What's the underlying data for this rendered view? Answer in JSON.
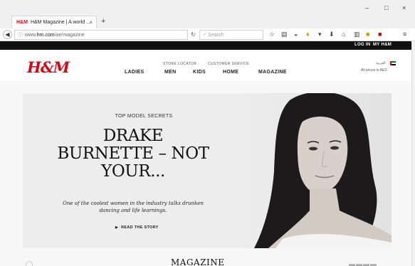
{
  "browser": {
    "tab_title": "H&M Magazine | A world ...",
    "tab_favicon": "H&M",
    "url_prefix": "www.",
    "url_domain": "hm.com",
    "url_path": "/ae/magazine",
    "search_placeholder": "Search",
    "window_controls": {
      "minimize": "–",
      "maximize": "□",
      "close": "×"
    }
  },
  "site": {
    "utility_top": {
      "login": "LOG IN",
      "myhm": "MY H&M"
    },
    "logo": "H&M",
    "utility_links": [
      "STORE LOCATOR",
      "CUSTOMER SERVICE"
    ],
    "nav": [
      "LADIES",
      "MEN",
      "KIDS",
      "HOME",
      "MAGAZINE"
    ],
    "region_arabic": "العربية",
    "prices_note": "All prices in AED",
    "colors": {
      "brand_red": "#e50010",
      "strip": "#111111"
    }
  },
  "hero": {
    "kicker": "TOP MODEL SECRETS",
    "headline_line1": "DRAKE",
    "headline_line2": "BURNETTE – NOT",
    "headline_line3": "YOUR...",
    "subtext_line1": "One of the coolest women in the industry talks drunken",
    "subtext_line2": "dancing and life learnings.",
    "cta": "READ THE STORY"
  },
  "below": {
    "section_title": "MAGAZINE"
  }
}
